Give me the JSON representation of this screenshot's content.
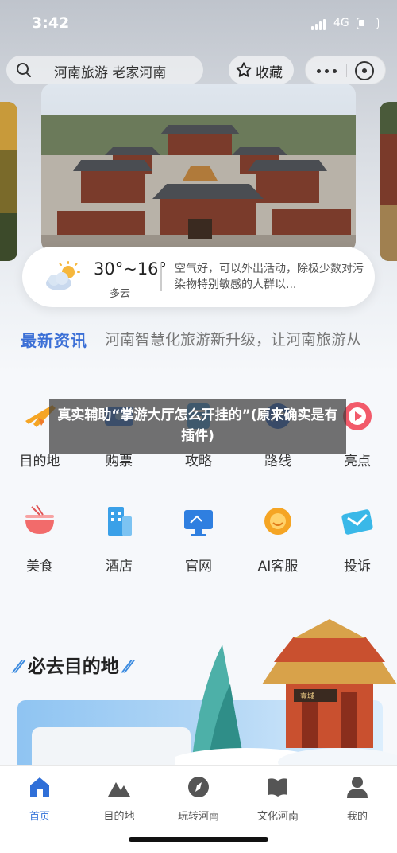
{
  "status_bar": {
    "time": "3:42",
    "network": "4G"
  },
  "search": {
    "text": "河南旅游 老家河南"
  },
  "header": {
    "favorite_label": "收藏"
  },
  "weather": {
    "temperature": "30°~16°",
    "condition": "多云",
    "tip": "空气好，可以外出活动，除极少数对污染物特别敏感的人群以..."
  },
  "news": {
    "title": "最新资讯",
    "headline": "河南智慧化旅游新升级，让河南旅游从"
  },
  "overlay": {
    "text": "真实辅助“掌游大厅怎么开挂的”(原来确实是有插件)"
  },
  "grid": {
    "items": [
      {
        "label": "目的地",
        "icon": "plane-icon"
      },
      {
        "label": "购票",
        "icon": "ticket-icon"
      },
      {
        "label": "攻略",
        "icon": "guide-icon"
      },
      {
        "label": "路线",
        "icon": "route-icon"
      },
      {
        "label": "亮点",
        "icon": "highlight-icon"
      },
      {
        "label": "美食",
        "icon": "food-icon"
      },
      {
        "label": "酒店",
        "icon": "hotel-icon"
      },
      {
        "label": "官网",
        "icon": "website-icon"
      },
      {
        "label": "AI客服",
        "icon": "ai-service-icon"
      },
      {
        "label": "投诉",
        "icon": "complaint-icon"
      }
    ]
  },
  "must_go": {
    "title": "必去目的地",
    "tower_sign": "壹城"
  },
  "bottom_nav": {
    "items": [
      {
        "label": "首页",
        "icon": "home-icon",
        "active": true
      },
      {
        "label": "目的地",
        "icon": "mountain-icon",
        "active": false
      },
      {
        "label": "玩转河南",
        "icon": "compass-icon",
        "active": false
      },
      {
        "label": "文化河南",
        "icon": "book-icon",
        "active": false
      },
      {
        "label": "我的",
        "icon": "user-icon",
        "active": false
      }
    ]
  },
  "colors": {
    "accent_blue": "#2f6fd8",
    "news_blue": "#3b6fd6",
    "text_dark": "#222222"
  }
}
